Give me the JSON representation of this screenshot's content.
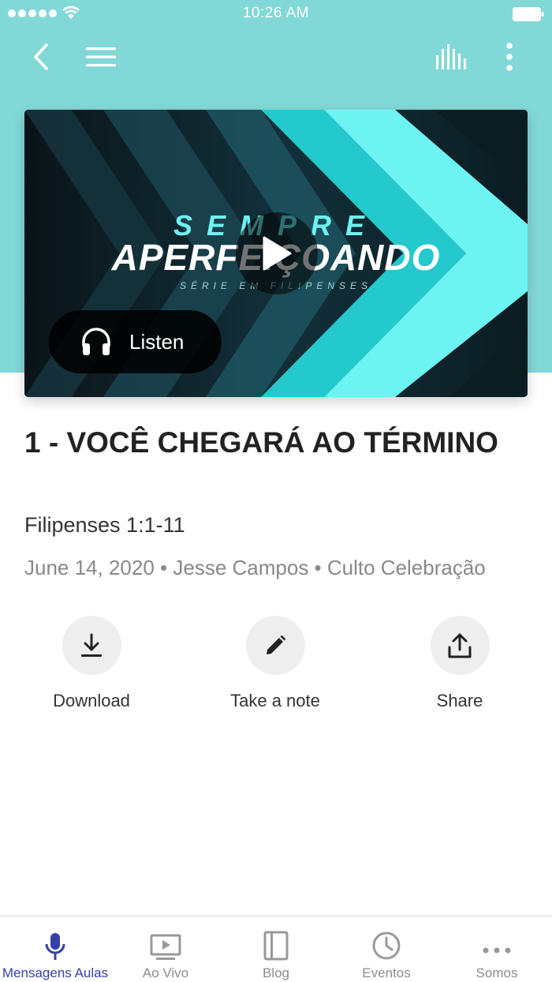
{
  "status_bar": {
    "time": "10:26 AM"
  },
  "hero": {
    "series_line1": "SEMPRE",
    "series_line2": "APERFEIÇOANDO",
    "series_line3": "SÉRIE EM FILIPENSES",
    "listen_label": "Listen"
  },
  "sermon": {
    "title": "1 - VOCÊ CHEGARÁ AO TÉRMINO",
    "passage": "Filipenses 1:1-11",
    "meta": "June 14, 2020 • Jesse Campos • Culto Celebração"
  },
  "actions": [
    {
      "label": "Download",
      "icon": "download-icon"
    },
    {
      "label": "Take a note",
      "icon": "pencil-icon"
    },
    {
      "label": "Share",
      "icon": "share-icon"
    }
  ],
  "tabs": [
    {
      "label": "Mensagens Aulas",
      "icon": "microphone-icon",
      "active": true
    },
    {
      "label": "Ao Vivo",
      "icon": "tv-play-icon"
    },
    {
      "label": "Blog",
      "icon": "book-icon"
    },
    {
      "label": "Eventos",
      "icon": "clock-icon"
    },
    {
      "label": "Somos",
      "icon": "more-dots-icon"
    }
  ],
  "colors": {
    "header": "#82d8d6",
    "accent_tab": "#3441a6",
    "hero_cyan": "#6ef3f3"
  }
}
